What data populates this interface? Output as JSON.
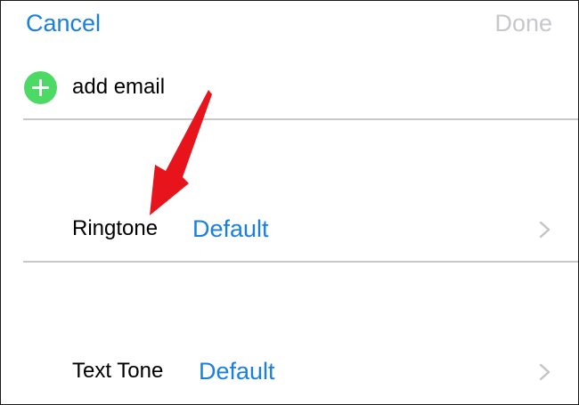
{
  "nav": {
    "cancel_label": "Cancel",
    "done_label": "Done"
  },
  "add_email": {
    "icon": "plus-circle-icon",
    "label": "add email"
  },
  "rows": [
    {
      "label": "Ringtone",
      "value": "Default",
      "icon": "chevron-right-icon"
    },
    {
      "label": "Text Tone",
      "value": "Default",
      "icon": "chevron-right-icon"
    }
  ],
  "colors": {
    "accent": "#1a7fe0",
    "disabled": "#c7c7cc",
    "add_green": "#4cd964",
    "divider": "#c8c8cc",
    "chevron": "#c4c4c7",
    "annotation_arrow": "#e8141b"
  }
}
